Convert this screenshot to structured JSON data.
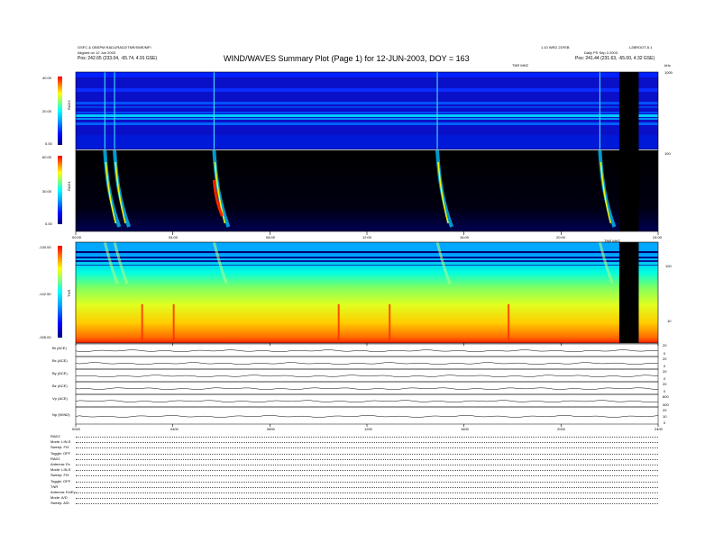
{
  "header": {
    "top_left_line1": "GSFC & OBSPM RAD1/RAD2/TNR/SWE/MFI",
    "top_left_line2": "Aligned on 12 Jun 2003",
    "top_left_pos": "Pos:  242.65 (233.04, -65.74, 4.91 GSE)",
    "top_right_line1": "1.10 WED 21FEB",
    "top_right_id": "L2BROOT-5.1",
    "top_right_line2": "Daily PS Sep 3 2003",
    "top_right_pos": "Pos:  241.44 (231.63, -65.00, 4.32 GSE)",
    "title": "WIND/WAVES Summary Plot (Page 1) for 12-JUN-2003, DOY = 163",
    "subtitle_right": "TNR MHZ",
    "subtitle_far_right": "kHz"
  },
  "panels": {
    "rad2": {
      "label": "RAD2",
      "scale_ticks": [
        "40.00",
        "20.00",
        "0.00"
      ],
      "right_ticks": [
        "1000"
      ]
    },
    "rad1": {
      "label": "RAD1",
      "scale_ticks": [
        "60.00",
        "30.00",
        "0.00"
      ],
      "right_ticks": [
        "100"
      ]
    },
    "tnr": {
      "label": "TNR",
      "scale_ticks": [
        "-130.00",
        "-142.50",
        "-155.00"
      ],
      "right_ticks": [
        "100",
        "10"
      ],
      "right_label": "TNR MHZ"
    }
  },
  "time_axis_mid": [
    "00:00",
    "04:00",
    "08:00",
    "12:00",
    "16:00",
    "20:00",
    "24:00"
  ],
  "time_axis_bottom": [
    "0000",
    "0400",
    "0800",
    "1200",
    "1600",
    "2000",
    "2400"
  ],
  "line_panels": [
    {
      "label": "Bt (ACE)",
      "right_ticks": [
        "20",
        "0"
      ]
    },
    {
      "label": "Bx (ACE)",
      "right_ticks": [
        "20",
        "0"
      ]
    },
    {
      "label": "By (ACE)",
      "right_ticks": [
        "20",
        "0"
      ]
    },
    {
      "label": "Bz (ACE)",
      "right_ticks": [
        "20",
        "0"
      ]
    },
    {
      "label": "Vp (ACE)",
      "right_ticks": [
        "800",
        "400"
      ]
    },
    {
      "label": "Np (WIND)",
      "right_ticks": [
        "20",
        "10",
        "0"
      ]
    }
  ],
  "footer": {
    "rows": [
      {
        "label": "RAD2"
      },
      {
        "label": "Mode:      LIN-S"
      },
      {
        "label": "Sweep:     FIX"
      },
      {
        "label": "Toggle:    OFF"
      },
      {
        "label": "RAD1"
      },
      {
        "label": "Antenna:   Ex"
      },
      {
        "label": "Mode:      LIN-S"
      },
      {
        "label": "Sweep:     FIX"
      },
      {
        "label": "Toggle:    OFF"
      },
      {
        "label": "TNR"
      },
      {
        "label": "Antenna:   Ex/Ey"
      },
      {
        "label": "Mode:      A/D"
      },
      {
        "label": "Sweep:     A/D"
      }
    ]
  },
  "chart_data": {
    "type": "heatmap",
    "title": "WIND/WAVES Summary Plot (Page 1) for 12-JUN-2003, DOY = 163",
    "x_range_hours": [
      0,
      24
    ],
    "data_gap_hours": [
      22.4,
      23.2
    ],
    "type_iii_bursts_hours": [
      1.2,
      1.6,
      5.7,
      14.9,
      21.6
    ],
    "colormap": [
      "#000080",
      "#0000ff",
      "#00a0ff",
      "#00ffff",
      "#80ff80",
      "#ffff00",
      "#ff8000",
      "#ff0000"
    ],
    "series": [
      {
        "name": "RAD2",
        "zlim": [
          0,
          40
        ]
      },
      {
        "name": "RAD1",
        "zlim": [
          0,
          60
        ]
      },
      {
        "name": "TNR",
        "zlim": [
          -155,
          -130
        ]
      }
    ]
  }
}
